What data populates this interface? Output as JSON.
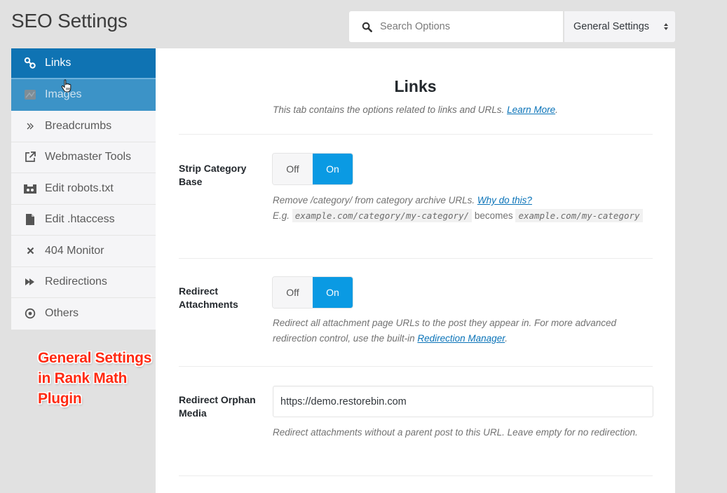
{
  "header": {
    "title": "SEO Settings",
    "search": {
      "placeholder": "Search Options",
      "value": ""
    },
    "settings_select": {
      "selected": "General Settings"
    }
  },
  "sidebar": {
    "items": [
      {
        "label": "Links",
        "icon": "link-icon",
        "state": "active"
      },
      {
        "label": "Images",
        "icon": "image-icon",
        "state": "hover"
      },
      {
        "label": "Breadcrumbs",
        "icon": "double-chevron-right-icon",
        "state": "normal"
      },
      {
        "label": "Webmaster Tools",
        "icon": "external-link-icon",
        "state": "normal"
      },
      {
        "label": "Edit robots.txt",
        "icon": "robot-icon",
        "state": "normal"
      },
      {
        "label": "Edit .htaccess",
        "icon": "file-icon",
        "state": "normal"
      },
      {
        "label": "404 Monitor",
        "icon": "close-icon",
        "state": "normal"
      },
      {
        "label": "Redirections",
        "icon": "fast-forward-icon",
        "state": "normal"
      },
      {
        "label": "Others",
        "icon": "circle-dot-icon",
        "state": "normal"
      }
    ]
  },
  "annotation": {
    "lines": [
      "General Settings",
      "in Rank Math",
      "Plugin"
    ],
    "color": "#ff2a12"
  },
  "panel": {
    "title": "Links",
    "description": "This tab contains the options related to links and URLs.",
    "learn_more": "Learn More",
    "fields": [
      {
        "label": "Strip Category Base",
        "type": "toggle",
        "off_label": "Off",
        "on_label": "On",
        "value": "On",
        "help": "Remove /category/ from category archive URLs.",
        "help_link": "Why do this?",
        "example_prefix": "E.g.",
        "example_from": "example.com/category/my-category/",
        "example_mid": "becomes",
        "example_to": "example.com/my-category"
      },
      {
        "label": "Redirect Attachments",
        "type": "toggle",
        "off_label": "Off",
        "on_label": "On",
        "value": "On",
        "help": "Redirect all attachment page URLs to the post they appear in. For more advanced redirection control, use the built-in",
        "help_link": "Redirection Manager"
      },
      {
        "label": "Redirect Orphan Media",
        "type": "text",
        "value": "https://demo.restorebin.com",
        "help": "Redirect attachments without a parent post to this URL. Leave empty for no redirection."
      }
    ]
  },
  "colors": {
    "active_tab": "#0f73b3",
    "hover_tab": "#3c93c7",
    "toggle_on": "#0a9ae3",
    "link": "#0a73b8",
    "background": "#e1e1e1"
  }
}
